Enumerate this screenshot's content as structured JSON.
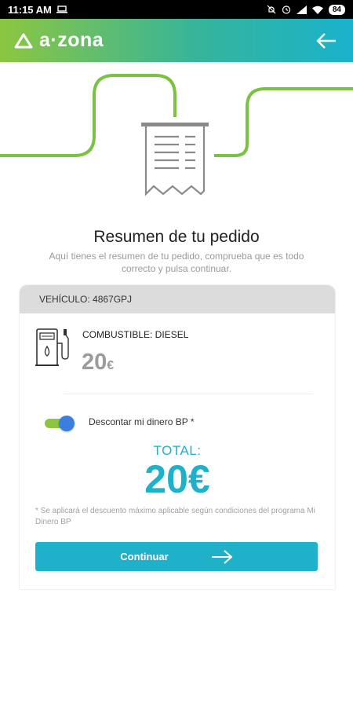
{
  "status_bar": {
    "time": "11:15 AM",
    "battery": "84",
    "icons": [
      "laptop-icon",
      "mute-icon",
      "alarm-icon",
      "signal-icon",
      "wifi-icon",
      "battery-icon"
    ]
  },
  "header": {
    "logo_text": "a·zona",
    "back_icon": "arrow-left-icon"
  },
  "colors": {
    "brand_green": "#8cc640",
    "brand_teal": "#1eb1c9",
    "toggle_knob": "#3a7fe0"
  },
  "summary": {
    "title": "Resumen de tu pedido",
    "subtitle": "Aquí tienes el resumen de tu pedido, comprueba que es todo correcto y pulsa continuar."
  },
  "order": {
    "vehicle": "VEHÍCULO: 4867GPJ",
    "fuel_label": "COMBUSTIBLE: DIESEL",
    "fuel_amount": "20",
    "fuel_currency": "€",
    "discount_label": "Descontar mi dinero BP *",
    "discount_enabled": true,
    "total_label": "TOTAL:",
    "total_value": "20€",
    "disclaimer": "* Se aplicará el descuento máximo aplicable según condiciones del programa Mi Dinero BP",
    "continue_label": "Continuar"
  }
}
